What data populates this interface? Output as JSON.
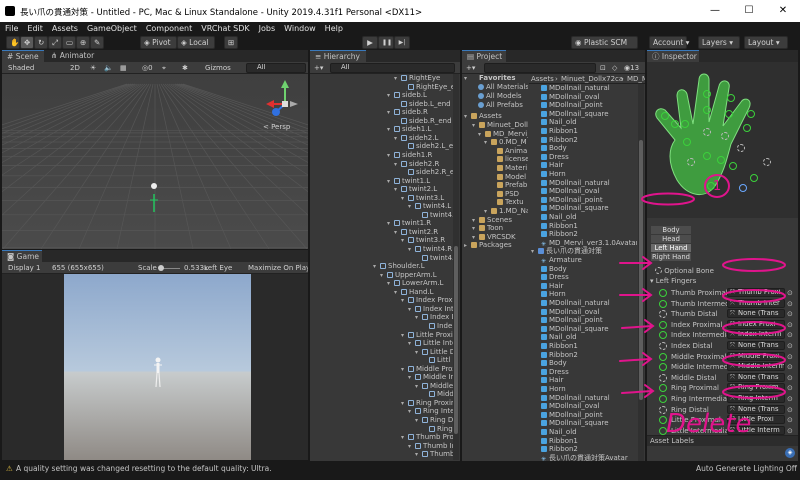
{
  "window": {
    "title": "長い爪の貫通対策 - Untitled - PC, Mac & Linux Standalone - Unity 2019.4.31f1 Personal <DX11>",
    "min": "—",
    "max": "☐",
    "close": "✕"
  },
  "menu": [
    "File",
    "Edit",
    "Assets",
    "GameObject",
    "Component",
    "VRChat SDK",
    "Jobs",
    "Window",
    "Help"
  ],
  "toolbar": {
    "pivot": "Pivot",
    "local": "Local",
    "play": "▶",
    "pause": "❚❚",
    "step": "▶|",
    "plastic": "Plastic SCM",
    "account": "Account ▾",
    "layers": "Layers ▾",
    "layout": "Layout ▾"
  },
  "scene": {
    "tab_scene": "Scene",
    "tab_animator": "Animator",
    "shading": "Shaded",
    "mode_2d": "2D",
    "gizmos": "Gizmos",
    "search": "All",
    "persp": "< Persp"
  },
  "game": {
    "tab": "Game",
    "display": "Display 1",
    "resolution": "655 (655x655)",
    "scale_label": "Scale",
    "scale_value": "0.533x",
    "eye": "Left Eye",
    "maximize": "Maximize On Play"
  },
  "hierarchy": {
    "tab": "Hierarchy",
    "search": "All",
    "items": [
      {
        "t": "RightEye",
        "d": 4,
        "f": true
      },
      {
        "t": "RightEye_end",
        "d": 5,
        "f": false
      },
      {
        "t": "sideb.L",
        "d": 3,
        "f": true
      },
      {
        "t": "sideb.L_end",
        "d": 4,
        "f": false
      },
      {
        "t": "sideb.R",
        "d": 3,
        "f": true
      },
      {
        "t": "sideb.R_end",
        "d": 4,
        "f": false
      },
      {
        "t": "sideh1.L",
        "d": 3,
        "f": true
      },
      {
        "t": "sideh2.L",
        "d": 4,
        "f": true
      },
      {
        "t": "sideh2.L_en",
        "d": 5,
        "f": false
      },
      {
        "t": "sideh1.R",
        "d": 3,
        "f": true
      },
      {
        "t": "sideh2.R",
        "d": 4,
        "f": true
      },
      {
        "t": "sideh2.R_en",
        "d": 5,
        "f": false
      },
      {
        "t": "twint1.L",
        "d": 3,
        "f": true
      },
      {
        "t": "twint2.L",
        "d": 4,
        "f": true
      },
      {
        "t": "twint3.L",
        "d": 5,
        "f": true
      },
      {
        "t": "twint4.L",
        "d": 6,
        "f": true
      },
      {
        "t": "twint4.",
        "d": 7,
        "f": false
      },
      {
        "t": "twint1.R",
        "d": 3,
        "f": true
      },
      {
        "t": "twint2.R",
        "d": 4,
        "f": true
      },
      {
        "t": "twint3.R",
        "d": 5,
        "f": true
      },
      {
        "t": "twint4.R",
        "d": 6,
        "f": true
      },
      {
        "t": "twint4.",
        "d": 7,
        "f": false
      },
      {
        "t": "Shoulder.L",
        "d": 1,
        "f": true
      },
      {
        "t": "UpperArm.L",
        "d": 2,
        "f": true
      },
      {
        "t": "LowerArm.L",
        "d": 3,
        "f": true
      },
      {
        "t": "Hand.L",
        "d": 4,
        "f": true
      },
      {
        "t": "Index Proxim",
        "d": 5,
        "f": true
      },
      {
        "t": "Index Inte",
        "d": 6,
        "f": true
      },
      {
        "t": "Index D",
        "d": 7,
        "f": true
      },
      {
        "t": "Inde",
        "d": 8,
        "f": false
      },
      {
        "t": "Little Proxim",
        "d": 5,
        "f": true
      },
      {
        "t": "Little Inte",
        "d": 6,
        "f": true
      },
      {
        "t": "Little D",
        "d": 7,
        "f": true
      },
      {
        "t": "Littl",
        "d": 8,
        "f": false
      },
      {
        "t": "Middle Prox",
        "d": 5,
        "f": true
      },
      {
        "t": "Middle Inte",
        "d": 6,
        "f": true
      },
      {
        "t": "Middle",
        "d": 7,
        "f": true
      },
      {
        "t": "Midd",
        "d": 8,
        "f": false
      },
      {
        "t": "Ring Proxim",
        "d": 5,
        "f": true
      },
      {
        "t": "Ring Inter",
        "d": 6,
        "f": true
      },
      {
        "t": "Ring Di",
        "d": 7,
        "f": true
      },
      {
        "t": "Ring",
        "d": 8,
        "f": false
      },
      {
        "t": "Thumb Prox",
        "d": 5,
        "f": true
      },
      {
        "t": "Thumb In",
        "d": 6,
        "f": true
      },
      {
        "t": "Thumb",
        "d": 7,
        "f": true
      }
    ]
  },
  "project": {
    "tab": "Project",
    "count": "13",
    "favorites": "Favorites",
    "fav_items": [
      "All Materials",
      "All Models",
      "All Prefabs"
    ],
    "assets": "Assets",
    "tree": [
      {
        "t": "Minuet_Dollx",
        "d": 1
      },
      {
        "t": "MD_Mervi_",
        "d": 2
      },
      {
        "t": "0.MD_M",
        "d": 3
      },
      {
        "t": "Anima",
        "d": 4
      },
      {
        "t": "license",
        "d": 4
      },
      {
        "t": "Materi",
        "d": 4
      },
      {
        "t": "Model",
        "d": 4
      },
      {
        "t": "Prefab",
        "d": 4
      },
      {
        "t": "PSD",
        "d": 4
      },
      {
        "t": "Textu",
        "d": 4
      },
      {
        "t": "1.MD_Na",
        "d": 3
      },
      {
        "t": "Scenes",
        "d": 1
      },
      {
        "t": "Toon",
        "d": 1
      },
      {
        "t": "VRCSDK",
        "d": 1
      }
    ],
    "packages": "Packages",
    "breadcrumb": [
      "Assets",
      "Minuet_Dollx72ca",
      "MD_M"
    ],
    "files": [
      {
        "t": "MDollnail_natural",
        "k": "mesh",
        "d": 0
      },
      {
        "t": "MDollnail_oval",
        "k": "mesh",
        "d": 0
      },
      {
        "t": "MDollnail_point",
        "k": "mesh",
        "d": 0
      },
      {
        "t": "MDollnail_square",
        "k": "mesh",
        "d": 0
      },
      {
        "t": "Nail_old",
        "k": "mesh",
        "d": 0
      },
      {
        "t": "Ribbon1",
        "k": "mesh",
        "d": 0
      },
      {
        "t": "Ribbon2",
        "k": "mesh",
        "d": 0
      },
      {
        "t": "Body",
        "k": "mesh",
        "d": 0
      },
      {
        "t": "Dress",
        "k": "mesh",
        "d": 0
      },
      {
        "t": "Hair",
        "k": "mesh",
        "d": 0
      },
      {
        "t": "Horn",
        "k": "mesh",
        "d": 0
      },
      {
        "t": "MDollnail_natural",
        "k": "mesh",
        "d": 0
      },
      {
        "t": "MDollnail_oval",
        "k": "mesh",
        "d": 0
      },
      {
        "t": "MDollnail_point",
        "k": "mesh",
        "d": 0
      },
      {
        "t": "MDollnail_square",
        "k": "mesh",
        "d": 0
      },
      {
        "t": "Nail_old",
        "k": "mesh",
        "d": 0
      },
      {
        "t": "Ribbon1",
        "k": "mesh",
        "d": 0
      },
      {
        "t": "Ribbon2",
        "k": "mesh",
        "d": 0
      },
      {
        "t": "MD_Mervi_ver3.1.0Avatar",
        "k": "avatar",
        "d": 0
      },
      {
        "t": "長い爪の貫通対策",
        "k": "pref",
        "d": -1
      },
      {
        "t": "Armature",
        "k": "avatar",
        "d": 0
      },
      {
        "t": "Body",
        "k": "mesh",
        "d": 0
      },
      {
        "t": "Dress",
        "k": "mesh",
        "d": 0
      },
      {
        "t": "Hair",
        "k": "mesh",
        "d": 0
      },
      {
        "t": "Horn",
        "k": "mesh",
        "d": 0
      },
      {
        "t": "MDollnail_natural",
        "k": "mesh",
        "d": 0
      },
      {
        "t": "MDollnail_oval",
        "k": "mesh",
        "d": 0
      },
      {
        "t": "MDollnail_point",
        "k": "mesh",
        "d": 0
      },
      {
        "t": "MDollnail_square",
        "k": "mesh",
        "d": 0
      },
      {
        "t": "Nail_old",
        "k": "mesh",
        "d": 0
      },
      {
        "t": "Ribbon1",
        "k": "mesh",
        "d": 0
      },
      {
        "t": "Ribbon2",
        "k": "mesh",
        "d": 0
      },
      {
        "t": "Body",
        "k": "mesh",
        "d": 0
      },
      {
        "t": "Dress",
        "k": "mesh",
        "d": 0
      },
      {
        "t": "Hair",
        "k": "mesh",
        "d": 0
      },
      {
        "t": "Horn",
        "k": "mesh",
        "d": 0
      },
      {
        "t": "MDollnail_natural",
        "k": "mesh",
        "d": 0
      },
      {
        "t": "MDollnail_oval",
        "k": "mesh",
        "d": 0
      },
      {
        "t": "MDollnail_point",
        "k": "mesh",
        "d": 0
      },
      {
        "t": "MDollnail_square",
        "k": "mesh",
        "d": 0
      },
      {
        "t": "Nail_old",
        "k": "mesh",
        "d": 0
      },
      {
        "t": "Ribbon1",
        "k": "mesh",
        "d": 0
      },
      {
        "t": "Ribbon2",
        "k": "mesh",
        "d": 0
      },
      {
        "t": "長い爪の貫通対策Avatar",
        "k": "avatar",
        "d": 0
      }
    ]
  },
  "inspector": {
    "tab": "Inspector",
    "body_buttons": [
      "Body",
      "Head",
      "Left Hand",
      "Right Hand"
    ],
    "optional_bone": "Optional Bone",
    "left_fingers": "Left Fingers",
    "fingers": [
      {
        "name": "Thumb Proximal",
        "value": "Thumb Proxi",
        "dashed": false
      },
      {
        "name": "Thumb Intermediate",
        "value": "Thumb Inter",
        "dashed": false
      },
      {
        "name": "Thumb Distal",
        "value": "None (Trans",
        "dashed": true
      },
      {
        "name": "Index Proximal",
        "value": "Index Proxi",
        "dashed": false
      },
      {
        "name": "Index Intermediate",
        "value": "Index Interm",
        "dashed": false
      },
      {
        "name": "Index Distal",
        "value": "None (Trans",
        "dashed": true
      },
      {
        "name": "Middle Proximal",
        "value": "Middle Proxi",
        "dashed": false
      },
      {
        "name": "Middle Intermediate",
        "value": "Middle Interm",
        "dashed": false
      },
      {
        "name": "Middle Distal",
        "value": "None (Trans",
        "dashed": true
      },
      {
        "name": "Ring Proximal",
        "value": "Ring Proxim",
        "dashed": false
      },
      {
        "name": "Ring Intermediate",
        "value": "Ring Interm",
        "dashed": false
      },
      {
        "name": "Ring Distal",
        "value": "None (Trans",
        "dashed": true
      },
      {
        "name": "Little Proximal",
        "value": "Little Proxi",
        "dashed": false
      },
      {
        "name": "Little Intermediate",
        "value": "Little Interm",
        "dashed": false
      },
      {
        "name": "Little Distal",
        "value": "None (Trans",
        "dashed": true
      }
    ],
    "asset_labels": "Asset Labels"
  },
  "annotations": {
    "circle1": "1",
    "delete": "Delete"
  },
  "status": {
    "message": "A quality setting was changed resetting to the default quality: Ultra.",
    "lighting": "Auto Generate Lighting Off"
  },
  "colors": {
    "accent": "#3a79bb",
    "bone_green": "#3bd13b",
    "annotation": "#e0148c"
  }
}
